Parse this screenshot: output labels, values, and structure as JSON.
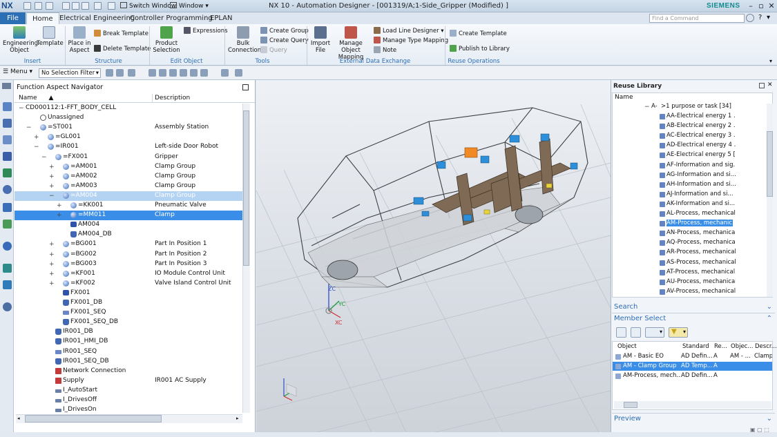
{
  "window": {
    "logo": "NX",
    "title": "NX 10 - Automation Designer - [001319/A;1-Side_Gripper (Modified) ]",
    "brand": "SIEMENS",
    "switch_window": "Switch Window",
    "window_menu": "Window",
    "search_placeholder": "Find a Command"
  },
  "tabs": [
    "File",
    "Home",
    "Electrical Engineering",
    "Controller Programming",
    "EPLAN"
  ],
  "ribbon": {
    "insert": {
      "label": "Insert",
      "engineering_object": "Engineering Object",
      "template": "Template"
    },
    "structure": {
      "label": "Structure",
      "place_in_aspect": "Place in Aspect",
      "break_template": "Break Template",
      "delete_template": "Delete Template"
    },
    "edit_object": {
      "label": "Edit Object",
      "product_selection": "Product Selection",
      "expressions": "Expressions"
    },
    "tools": {
      "label": "Tools",
      "bulk_connection": "Bulk Connection",
      "create_group": "Create Group",
      "create_query": "Create Query",
      "query": "Query"
    },
    "external": {
      "label": "External Data Exchange",
      "import_file": "Import File",
      "manage_object_mapping": "Manage Object Mapping",
      "load_line_designer": "Load Line Designer",
      "manage_type_mapping": "Manage Type Mapping",
      "note": "Note"
    },
    "reuse_ops": {
      "label": "Reuse Operations",
      "create_template": "Create Template",
      "publish_to_library": "Publish to Library"
    }
  },
  "toolbar": {
    "menu": "Menu",
    "selection_filter": "No Selection Filter"
  },
  "navigator": {
    "title": "Function Aspect Navigator",
    "col_name": "Name",
    "col_desc": "Description",
    "rows": [
      {
        "name": "CD000112:1-FFT_BODY_CELL",
        "desc": "",
        "indent": 0,
        "exp": "−",
        "icon": "none"
      },
      {
        "name": "Unassigned",
        "desc": "",
        "indent": 1,
        "exp": "",
        "icon": "un"
      },
      {
        "name": "=ST001",
        "desc": "Assembly Station",
        "indent": 1,
        "exp": "−",
        "icon": "ball"
      },
      {
        "name": "=GL001",
        "desc": "",
        "indent": 2,
        "exp": "+",
        "icon": "ball"
      },
      {
        "name": "=IR001",
        "desc": "Left-side Door Robot",
        "indent": 2,
        "exp": "−",
        "icon": "ball"
      },
      {
        "name": "=FX001",
        "desc": "Gripper",
        "indent": 3,
        "exp": "−",
        "icon": "ball"
      },
      {
        "name": "=AM001",
        "desc": "Clamp Group",
        "indent": 4,
        "exp": "+",
        "icon": "ball"
      },
      {
        "name": "=AM002",
        "desc": "Clamp Group",
        "indent": 4,
        "exp": "+",
        "icon": "ball"
      },
      {
        "name": "=AM003",
        "desc": "Clamp Group",
        "indent": 4,
        "exp": "+",
        "icon": "ball"
      },
      {
        "name": "=AM004",
        "desc": "Clamp Group",
        "indent": 4,
        "exp": "−",
        "icon": "ball",
        "sel": 1
      },
      {
        "name": "=KK001",
        "desc": "Pneumatic Valve",
        "indent": 5,
        "exp": "+",
        "icon": "ball"
      },
      {
        "name": "=MM011",
        "desc": "Clamp",
        "indent": 5,
        "exp": "+",
        "icon": "ball",
        "sel": 2
      },
      {
        "name": "AM004",
        "desc": "",
        "indent": 5,
        "exp": "",
        "icon": "blk"
      },
      {
        "name": "AM004_DB",
        "desc": "",
        "indent": 5,
        "exp": "",
        "icon": "db"
      },
      {
        "name": "=BG001",
        "desc": "Part In Position 1",
        "indent": 4,
        "exp": "+",
        "icon": "ball"
      },
      {
        "name": "=BG002",
        "desc": "Part In Position 2",
        "indent": 4,
        "exp": "+",
        "icon": "ball"
      },
      {
        "name": "=BG003",
        "desc": "Part In Position 3",
        "indent": 4,
        "exp": "+",
        "icon": "ball"
      },
      {
        "name": "=KF001",
        "desc": "IO Module Control Unit",
        "indent": 4,
        "exp": "+",
        "icon": "ball"
      },
      {
        "name": "=KF002",
        "desc": "Valve Island Control Unit",
        "indent": 4,
        "exp": "+",
        "icon": "ball"
      },
      {
        "name": "FX001",
        "desc": "",
        "indent": 4,
        "exp": "",
        "icon": "blk"
      },
      {
        "name": "FX001_DB",
        "desc": "",
        "indent": 4,
        "exp": "",
        "icon": "db"
      },
      {
        "name": "FX001_SEQ",
        "desc": "",
        "indent": 4,
        "exp": "",
        "icon": "seq"
      },
      {
        "name": "FX001_SEQ_DB",
        "desc": "",
        "indent": 4,
        "exp": "",
        "icon": "db"
      },
      {
        "name": "IR001_DB",
        "desc": "",
        "indent": 3,
        "exp": "",
        "icon": "db"
      },
      {
        "name": "IR001_HMI_DB",
        "desc": "",
        "indent": 3,
        "exp": "",
        "icon": "db"
      },
      {
        "name": "IR001_SEQ",
        "desc": "",
        "indent": 3,
        "exp": "",
        "icon": "seq"
      },
      {
        "name": "IR001_SEQ_DB",
        "desc": "",
        "indent": 3,
        "exp": "",
        "icon": "db"
      },
      {
        "name": "Network Connection",
        "desc": "",
        "indent": 3,
        "exp": "",
        "icon": "net"
      },
      {
        "name": "Supply",
        "desc": "IR001 AC Supply",
        "indent": 3,
        "exp": "",
        "icon": "net"
      },
      {
        "name": "I_AutoStart",
        "desc": "",
        "indent": 3,
        "exp": "",
        "icon": "sig"
      },
      {
        "name": "I_DrivesOff",
        "desc": "",
        "indent": 3,
        "exp": "",
        "icon": "sig"
      },
      {
        "name": "I_DrivesOn",
        "desc": "",
        "indent": 3,
        "exp": "",
        "icon": "sig"
      }
    ]
  },
  "viewport": {
    "axis_zc": "ZC",
    "axis_yc": "YC",
    "axis_xc": "XC"
  },
  "reuse_library": {
    "title": "Reuse Library",
    "col_name": "Name",
    "root": ">1 purpose or task [34]",
    "items": [
      "AA-Electrical energy 1 ...",
      "AB-Electrical energy 2 ...",
      "AC-Electrical energy 3 ...",
      "AD-Electrical energy 4 ...",
      "AE-Electrical energy 5 [E...",
      "AF-Information and sig...",
      "AG-Information and si...",
      "AH-Information and si...",
      "AJ-Information and si...",
      "AK-Information and si...",
      "AL-Process, mechanical...",
      "AM-Process, mechanic...",
      "AN-Process, mechanical...",
      "AQ-Process, mechanical...",
      "AR-Process, mechanical...",
      "AS-Process, mechanical...",
      "AT-Process, mechanical...",
      "AU-Process, mechanical...",
      "AV-Process, mechanical..."
    ],
    "selected_index": 11
  },
  "search_panel": {
    "label": "Search"
  },
  "member_select": {
    "label": "Member Select",
    "columns": [
      "Object",
      "Standard",
      "Re...",
      "Objec...",
      "Descr..."
    ],
    "rows": [
      [
        "AM - Basic EO",
        "AD Defin...",
        "A",
        "AM - ...",
        "Clamp"
      ],
      [
        "AM - Clamp Group",
        "AD Temp...",
        "A",
        "",
        ""
      ],
      [
        "AM-Process, mech...",
        "AD Defin...",
        "A",
        "",
        ""
      ]
    ],
    "selected_index": 1
  },
  "preview_panel": {
    "label": "Preview"
  },
  "colors": {
    "accent": "#2b6db5",
    "selection": "#3b8ee8",
    "selection_light": "#b4d3f2"
  }
}
